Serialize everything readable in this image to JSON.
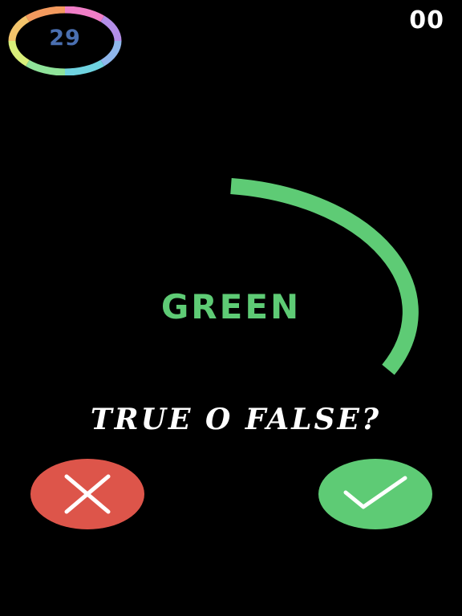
{
  "timer": {
    "value": "29",
    "ring_colors": [
      "#e96a8c",
      "#f07ec7",
      "#b48ee8",
      "#8fb7ec",
      "#6fd3e0",
      "#8fe39a",
      "#d9ef7a",
      "#f3c46b",
      "#f39a5e"
    ]
  },
  "score": {
    "value": "00"
  },
  "progress_arc": {
    "color": "#5ecb75",
    "fraction_remaining": 0.35
  },
  "prompt": {
    "color_word": "GREEN",
    "color_word_color": "#5ecb75",
    "question": "TRUE O FALSE?"
  },
  "buttons": {
    "false": {
      "icon": "x-icon",
      "color": "#dd554a"
    },
    "true": {
      "icon": "checkmark-icon",
      "color": "#5ecb75"
    }
  }
}
